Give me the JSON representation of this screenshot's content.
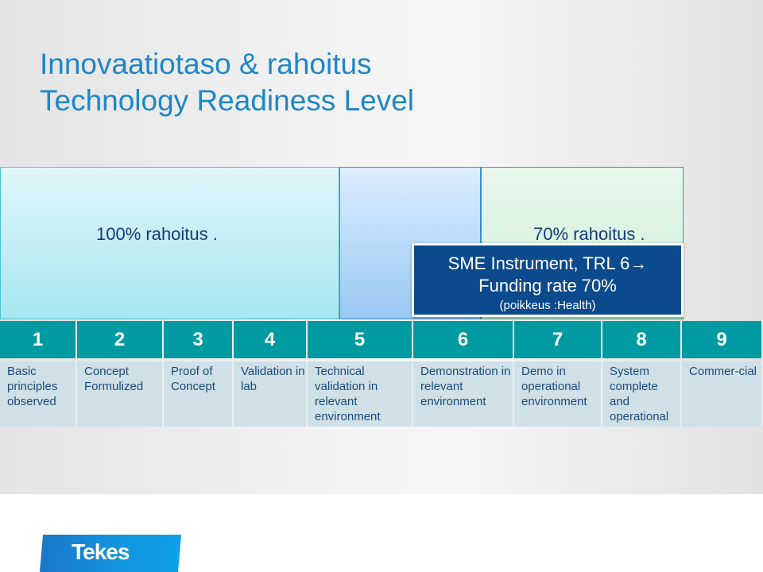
{
  "title": {
    "line1": "Innovaatiotaso & rahoitus",
    "line2": "Technology Readiness Level"
  },
  "zones": {
    "full_funding": "100% rahoitus    .",
    "partial_funding": "70% rahoitus    ."
  },
  "sme_box": {
    "line1": "SME Instrument, TRL 6→",
    "line2": "Funding rate 70%",
    "line3": "(poikkeus :Health)"
  },
  "levels": [
    {
      "num": "1",
      "desc": "Basic principles observed"
    },
    {
      "num": "2",
      "desc": "Concept Formulized"
    },
    {
      "num": "3",
      "desc": "Proof of Concept"
    },
    {
      "num": "4",
      "desc": "Validation in lab"
    },
    {
      "num": "5",
      "desc": "Technical validation in relevant environment"
    },
    {
      "num": "6",
      "desc": "Demonstration in relevant environment"
    },
    {
      "num": "7",
      "desc": "Demo in operational environment"
    },
    {
      "num": "8",
      "desc": "System complete and operational"
    },
    {
      "num": "9",
      "desc": "Commer-cial"
    }
  ],
  "logo": {
    "text": "Tekes"
  },
  "colors": {
    "title": "#1e86c8",
    "header": "#009aa2",
    "sme_box": "#0b4a8c"
  }
}
